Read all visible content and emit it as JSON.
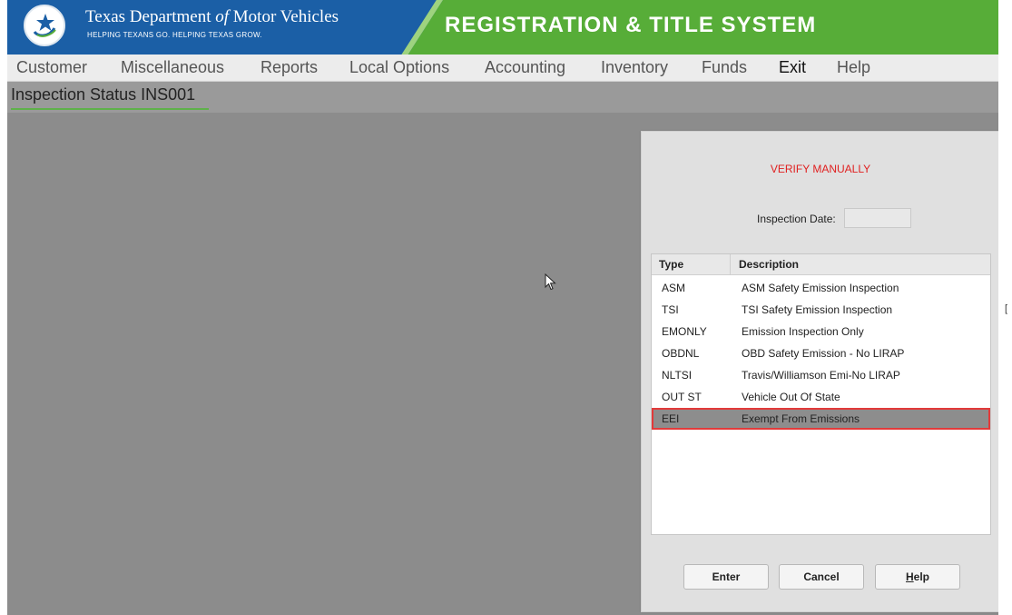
{
  "header": {
    "dept_name_a": "Texas Department ",
    "dept_name_of": "of",
    "dept_name_b": " Motor Vehicles",
    "tagline": "HELPING TEXANS GO. HELPING TEXAS GROW.",
    "system_title": "REGISTRATION & TITLE SYSTEM"
  },
  "menu": {
    "customer": "Customer",
    "miscellaneous": "Miscellaneous",
    "reports": "Reports",
    "local_options": "Local Options",
    "accounting": "Accounting",
    "inventory": "Inventory",
    "funds": "Funds",
    "exit": "Exit",
    "help": "Help"
  },
  "page": {
    "title": "Inspection Status INS001"
  },
  "dialog": {
    "verify_text": "VERIFY MANUALLY",
    "inspection_date_label": "Inspection Date:",
    "inspection_date_value": "",
    "columns": {
      "type": "Type",
      "description": "Description"
    },
    "rows": [
      {
        "type": "ASM",
        "description": "ASM Safety Emission Inspection"
      },
      {
        "type": "TSI",
        "description": "TSI Safety Emission Inspection"
      },
      {
        "type": "EMONLY",
        "description": "Emission Inspection Only"
      },
      {
        "type": "OBDNL",
        "description": "OBD Safety Emission - No LIRAP"
      },
      {
        "type": "NLTSI",
        "description": "Travis/Williamson Emi-No LIRAP"
      },
      {
        "type": "OUT ST",
        "description": "Vehicle Out Of State"
      },
      {
        "type": "EEI",
        "description": "Exempt From Emissions"
      }
    ],
    "selected_row": "EEI",
    "buttons": {
      "enter": "Enter",
      "cancel": "Cancel",
      "help_h": "H",
      "help_rest": "elp"
    }
  },
  "colors": {
    "header_green": "#57ad38",
    "header_blue": "#1b5fa6",
    "verify_red": "#e02020",
    "selection_outline": "#e23a3a",
    "title_underline": "#5fb14a"
  },
  "edge_mark": "[",
  "icons": {
    "logo": "star-swoosh-logo",
    "cursor": "mouse-pointer"
  }
}
